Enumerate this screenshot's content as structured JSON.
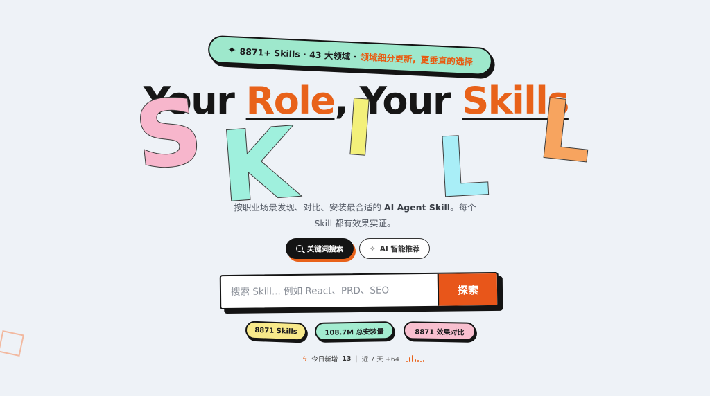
{
  "top_pill": {
    "sparkle_icon": "sparkle-icon",
    "prefix": "8871+ Skills · 43 大领域 ·",
    "accent_text": "领域细分更新，更垂直的选择"
  },
  "headline": {
    "word1": "Your ",
    "word2": "Role",
    "word3": ", Your ",
    "word4": "Skills"
  },
  "floating_letters": {
    "s": "S",
    "k": "K",
    "i": "I",
    "l1": "L",
    "l2": "L"
  },
  "subtitle": {
    "line1_a": "按职业场景发现、对比、安装最合适的 ",
    "line1_b": "AI Agent Skill",
    "line1_c": "。每个",
    "line2": "Skill 都有效果实证。"
  },
  "modes": {
    "keyword_label": "关键词搜索",
    "ai_label": "AI 智能推荐"
  },
  "search": {
    "placeholder": "搜索 Skill... 例如 React、PRD、SEO",
    "value": "",
    "button_label": "探索"
  },
  "stats": {
    "skills": "8871 Skills",
    "installs": "108.7M 总安装量",
    "comparisons": "8871 效果对比"
  },
  "today": {
    "label": "今日新增",
    "count": "13",
    "separator": "|",
    "week_label": "近 7 天 +64",
    "sparkline": [
      2,
      6,
      9,
      4,
      3,
      2,
      3
    ]
  },
  "colors": {
    "accent": "#e8621a",
    "mint": "#9ee8cc",
    "yellow": "#f7e98a",
    "pink": "#f8bfcf",
    "background": "#eef2f7"
  }
}
